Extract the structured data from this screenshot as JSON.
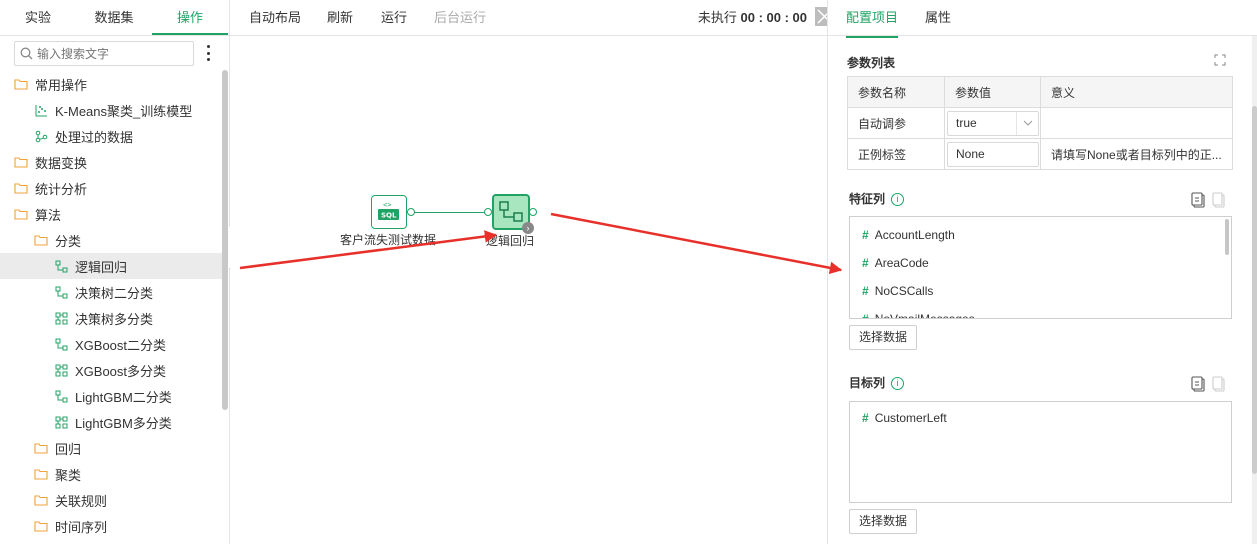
{
  "left_tabs": [
    "实验",
    "数据集",
    "操作"
  ],
  "search": {
    "placeholder": "输入搜索文字"
  },
  "tree": [
    {
      "label": "常用操作",
      "icon": "folder-icon",
      "level": 0
    },
    {
      "label": "K-Means聚类_训练模型",
      "icon": "scatter-chart-icon",
      "level": 1
    },
    {
      "label": "处理过的数据",
      "icon": "branch-icon",
      "level": 1
    },
    {
      "label": "数据变换",
      "icon": "folder-icon",
      "level": 0
    },
    {
      "label": "统计分析",
      "icon": "folder-icon",
      "level": 0
    },
    {
      "label": "算法",
      "icon": "folder-icon",
      "level": 0
    },
    {
      "label": "分类",
      "icon": "folder-icon",
      "level": 1
    },
    {
      "label": "逻辑回归",
      "icon": "tree-model-icon",
      "level": 2,
      "selected": true
    },
    {
      "label": "决策树二分类",
      "icon": "tree-model-icon",
      "level": 2
    },
    {
      "label": "决策树多分类",
      "icon": "multi-tree-model-icon",
      "level": 2
    },
    {
      "label": "XGBoost二分类",
      "icon": "tree-model-icon",
      "level": 2
    },
    {
      "label": "XGBoost多分类",
      "icon": "multi-tree-model-icon",
      "level": 2
    },
    {
      "label": "LightGBM二分类",
      "icon": "tree-model-icon",
      "level": 2
    },
    {
      "label": "LightGBM多分类",
      "icon": "multi-tree-model-icon",
      "level": 2
    },
    {
      "label": "回归",
      "icon": "folder-icon",
      "level": 1
    },
    {
      "label": "聚类",
      "icon": "folder-icon",
      "level": 1
    },
    {
      "label": "关联规则",
      "icon": "folder-icon",
      "level": 1
    },
    {
      "label": "时间序列",
      "icon": "folder-icon",
      "level": 1
    }
  ],
  "toolbar": {
    "auto_layout": "自动布局",
    "refresh": "刷新",
    "run": "运行",
    "bg_run": "后台运行",
    "status_label": "未执行",
    "status_time": "00 : 00 : 00"
  },
  "canvas": {
    "node_sql_label": "客户流失测试数据",
    "node_sql_icon_text": "SQL",
    "node_lr_label": "逻辑回归"
  },
  "right_tabs": [
    "配置项目",
    "属性"
  ],
  "params": {
    "title": "参数列表",
    "headers": [
      "参数名称",
      "参数值",
      "意义"
    ],
    "rows": [
      {
        "name": "自动调参",
        "value": "true",
        "meaning": ""
      },
      {
        "name": "正例标签",
        "value": "None",
        "meaning": "请填写None或者目标列中的正..."
      }
    ]
  },
  "features": {
    "title": "特征列",
    "items": [
      "AccountLength",
      "AreaCode",
      "NoCSCalls",
      "NoVmailMessages"
    ],
    "button": "选择数据"
  },
  "target": {
    "title": "目标列",
    "items": [
      "CustomerLeft"
    ],
    "button": "选择数据"
  },
  "colors": {
    "accent": "#21a366",
    "arrow": "#e8302a"
  }
}
